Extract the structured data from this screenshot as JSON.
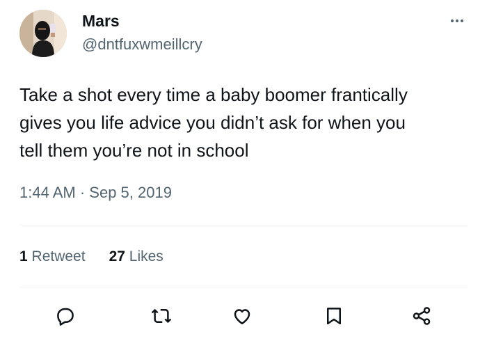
{
  "tweet": {
    "author": {
      "name": "Mars",
      "handle": "@dntfuxwmeillcry"
    },
    "text_lines": [
      "Take a shot every time a baby boomer frantically",
      "gives you life advice you didn’t ask for when you",
      "tell them you’re not in school"
    ],
    "time": "1:44 AM",
    "separator": "·",
    "date": "Sep 5, 2019",
    "stats": {
      "retweets_count": "1",
      "retweets_label": "Retweet",
      "likes_count": "27",
      "likes_label": "Likes"
    }
  },
  "icons": {
    "more": "more-horizontal-icon",
    "reply": "reply-icon",
    "retweet": "retweet-icon",
    "like": "heart-icon",
    "bookmark": "bookmark-icon",
    "share": "share-icon"
  },
  "colors": {
    "text_primary": "#0f1419",
    "text_secondary": "#536471",
    "divider": "#eff3f4"
  }
}
